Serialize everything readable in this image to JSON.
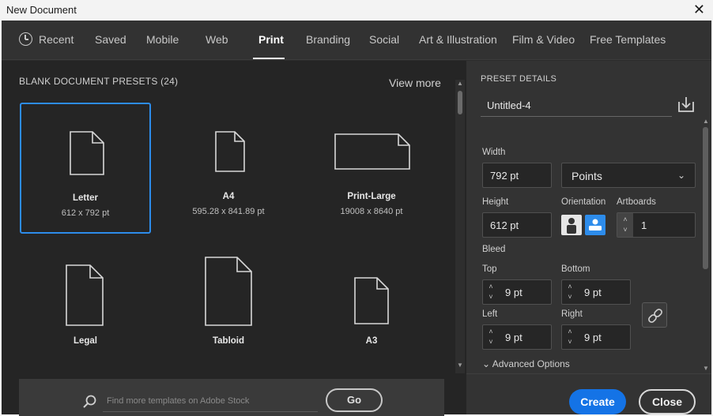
{
  "window": {
    "title": "New Document",
    "close_glyph": "✕"
  },
  "tabs": [
    {
      "label": "Recent",
      "icon": "clock-icon"
    },
    {
      "label": "Saved"
    },
    {
      "label": "Mobile"
    },
    {
      "label": "Web"
    },
    {
      "label": "Print",
      "active": true
    },
    {
      "label": "Branding"
    },
    {
      "label": "Social"
    },
    {
      "label": "Art & Illustration"
    },
    {
      "label": "Film & Video"
    },
    {
      "label": "Free Templates"
    }
  ],
  "presets": {
    "header": "BLANK DOCUMENT PRESETS",
    "count": "(24)",
    "view_more": "View more",
    "items": [
      {
        "name": "Letter",
        "size": "612 x 792 pt",
        "selected": true
      },
      {
        "name": "A4",
        "size": "595.28 x 841.89 pt"
      },
      {
        "name": "Print-Large",
        "size": "19008 x 8640 pt"
      },
      {
        "name": "Legal",
        "size": ""
      },
      {
        "name": "Tabloid",
        "size": ""
      },
      {
        "name": "A3",
        "size": ""
      }
    ]
  },
  "search": {
    "placeholder": "Find more templates on Adobe Stock",
    "go_label": "Go"
  },
  "details": {
    "header": "PRESET DETAILS",
    "doc_name": "Untitled-4",
    "width_label": "Width",
    "width_value": "792 pt",
    "units": "Points",
    "height_label": "Height",
    "height_value": "612 pt",
    "orientation_label": "Orientation",
    "artboards_label": "Artboards",
    "artboards_value": "1",
    "bleed_label": "Bleed",
    "top_label": "Top",
    "top_value": "9 pt",
    "bottom_label": "Bottom",
    "bottom_value": "9 pt",
    "left_label": "Left",
    "left_value": "9 pt",
    "right_label": "Right",
    "right_value": "9 pt",
    "advanced_label": "Advanced Options",
    "create_label": "Create",
    "close_label": "Close"
  },
  "colors": {
    "accent": "#1473e6",
    "selected_border": "#2d8ceb",
    "panel": "#333333",
    "background": "#252525"
  }
}
